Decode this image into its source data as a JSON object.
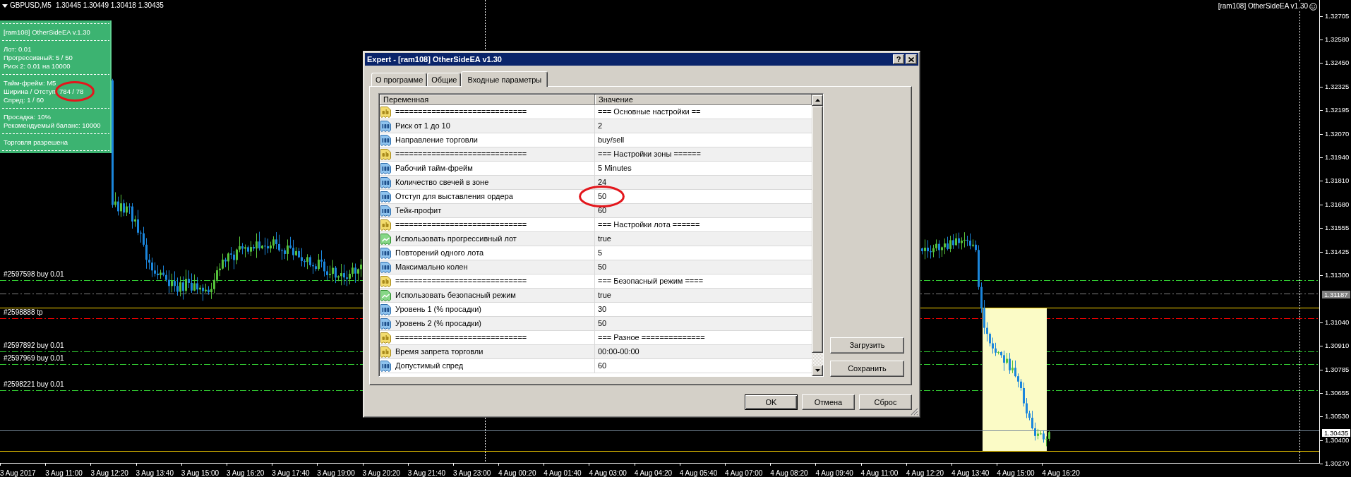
{
  "chart": {
    "symbol": "GBPUSD,M5",
    "quotes": "1.30445 1.30449 1.30418 1.30435",
    "expert_label": "[ram108] OtherSideEA v1.30",
    "levels": [
      {
        "kind": "dashed",
        "color": "#32cd32",
        "label": "#2597598 buy 0.01"
      },
      {
        "kind": "dashed",
        "color": "#808080"
      },
      {
        "kind": "solid",
        "color": "#ffd700"
      },
      {
        "kind": "dashed",
        "color": "#ff0000",
        "label": "#2598888 tp"
      },
      {
        "kind": "dashed",
        "color": "#32cd32",
        "label": "#2597892 buy 0.01"
      },
      {
        "kind": "dashed",
        "color": "#32cd32",
        "label": "#2597969 buy 0.01"
      },
      {
        "kind": "dashed",
        "color": "#32cd32",
        "label": "#2598221 buy 0.01"
      },
      {
        "kind": "solid",
        "color": "#778899"
      },
      {
        "kind": "solid",
        "color": "#ffd700"
      }
    ],
    "price_axis": [
      {
        "kind": "tick",
        "text": "1.32705"
      },
      {
        "kind": "tick",
        "text": "1.32580"
      },
      {
        "kind": "tick",
        "text": "1.32450"
      },
      {
        "kind": "tick",
        "text": "1.32325"
      },
      {
        "kind": "tick",
        "text": "1.32195"
      },
      {
        "kind": "tick",
        "text": "1.32070"
      },
      {
        "kind": "tick",
        "text": "1.31940"
      },
      {
        "kind": "tick",
        "text": "1.31810"
      },
      {
        "kind": "tick",
        "text": "1.31680"
      },
      {
        "kind": "tick",
        "text": "1.31555"
      },
      {
        "kind": "tick",
        "text": "1.31425"
      },
      {
        "kind": "tick",
        "text": "1.31300"
      },
      {
        "kind": "marker",
        "text": "1.31187"
      },
      {
        "kind": "tick",
        "text": "1.31040"
      },
      {
        "kind": "tick",
        "text": "1.30910"
      },
      {
        "kind": "tick",
        "text": "1.30785"
      },
      {
        "kind": "tick",
        "text": "1.30655"
      },
      {
        "kind": "tick",
        "text": "1.30530"
      },
      {
        "kind": "current",
        "text": "1.30435"
      },
      {
        "kind": "tick",
        "text": "1.30400"
      },
      {
        "kind": "tick",
        "text": "1.30270"
      }
    ],
    "time_axis": [
      "3 Aug 2017",
      "3 Aug 11:00",
      "3 Aug 12:20",
      "3 Aug 13:40",
      "3 Aug 15:00",
      "3 Aug 16:20",
      "3 Aug 17:40",
      "3 Aug 19:00",
      "3 Aug 20:20",
      "3 Aug 21:40",
      "3 Aug 23:00",
      "4 Aug 00:20",
      "4 Aug 01:40",
      "4 Aug 03:00",
      "4 Aug 04:20",
      "4 Aug 05:40",
      "4 Aug 07:00",
      "4 Aug 08:20",
      "4 Aug 09:40",
      "4 Aug 11:00",
      "4 Aug 12:20",
      "4 Aug 13:40",
      "4 Aug 15:00",
      "4 Aug 16:20"
    ]
  },
  "info_panel": {
    "sections": [
      {
        "lines": [
          {
            "text": "[ram108] OtherSideEA v.1.30",
            "highlighted": false
          }
        ]
      },
      {
        "lines": [
          {
            "text": "Лот: 0.01",
            "highlighted": false
          },
          {
            "text": "Прогрессивный: 5 / 50",
            "highlighted": false
          },
          {
            "text": "Риск 2: 0.01 на 10000",
            "highlighted": false
          }
        ]
      },
      {
        "lines": [
          {
            "text": "Тайм-фрейм: M5",
            "highlighted": false
          },
          {
            "text": "Ширина / Отступ: 784 / 78",
            "highlighted": true
          },
          {
            "text": "Спред: 1 / 60",
            "highlighted": false
          }
        ]
      },
      {
        "lines": [
          {
            "text": "Просадка: 10%",
            "highlighted": false
          },
          {
            "text": "Рекомендуемый баланс: 10000",
            "highlighted": false
          }
        ]
      },
      {
        "lines": [
          {
            "text": "Торговля разрешена",
            "highlighted": false
          }
        ]
      }
    ]
  },
  "dialog": {
    "title": "Expert - [ram108] OtherSideEA v1.30",
    "help_button": "?",
    "tabs": [
      {
        "label": "О программе",
        "selected": false
      },
      {
        "label": "Общие",
        "selected": false
      },
      {
        "label": "Входные параметры",
        "selected": true
      }
    ],
    "table": {
      "columns": [
        "Переменная",
        "Значение"
      ],
      "rows": [
        {
          "kind": "string",
          "name": "=============================",
          "value": "=== Основные настройки ==",
          "highlighted": false
        },
        {
          "kind": "number",
          "name": "Риск от 1 до 10",
          "value": "2",
          "highlighted": false
        },
        {
          "kind": "number",
          "name": "Направление торговли",
          "value": "buy/sell",
          "highlighted": false
        },
        {
          "kind": "string",
          "name": "=============================",
          "value": "=== Настройки зоны ======",
          "highlighted": false
        },
        {
          "kind": "number",
          "name": "Рабочий тайм-фрейм",
          "value": "5 Minutes",
          "highlighted": false
        },
        {
          "kind": "number",
          "name": "Количество свечей в зоне",
          "value": "24",
          "highlighted": false
        },
        {
          "kind": "number",
          "name": "Отступ для выставления ордера",
          "value": "50",
          "highlighted": true
        },
        {
          "kind": "number",
          "name": "Тейк-профит",
          "value": "60",
          "highlighted": false
        },
        {
          "kind": "string",
          "name": "=============================",
          "value": "=== Настройки лота ======",
          "highlighted": false
        },
        {
          "kind": "bool",
          "name": "Использовать прогрессивный лот",
          "value": "true",
          "highlighted": false
        },
        {
          "kind": "number",
          "name": "Повторений одного лота",
          "value": "5",
          "highlighted": false
        },
        {
          "kind": "number",
          "name": "Максимально колен",
          "value": "50",
          "highlighted": false
        },
        {
          "kind": "string",
          "name": "=============================",
          "value": "=== Безопасный режим ====",
          "highlighted": false
        },
        {
          "kind": "bool",
          "name": "Использовать безопасный режим",
          "value": "true",
          "highlighted": false
        },
        {
          "kind": "number",
          "name": "Уровень 1 (% просадки)",
          "value": "30",
          "highlighted": false
        },
        {
          "kind": "number",
          "name": "Уровень 2 (% просадки)",
          "value": "50",
          "highlighted": false
        },
        {
          "kind": "string",
          "name": "=============================",
          "value": "=== Разное ==============",
          "highlighted": false
        },
        {
          "kind": "string",
          "name": "Время запрета торговли",
          "value": "00:00-00:00",
          "highlighted": false
        },
        {
          "kind": "number",
          "name": "Допустимый спред",
          "value": "60",
          "highlighted": false
        }
      ]
    },
    "side_buttons": [
      "Загрузить",
      "Сохранить"
    ],
    "buttons": [
      {
        "label": "OK",
        "default": true
      },
      {
        "label": "Отмена",
        "default": false
      },
      {
        "label": "Сброс",
        "default": false
      }
    ]
  }
}
